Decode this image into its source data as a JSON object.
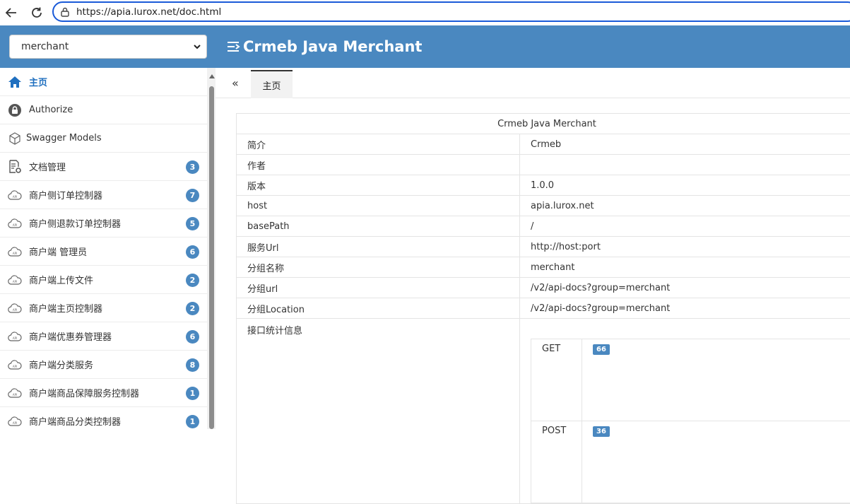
{
  "browser": {
    "url": "https://apia.lurox.net/doc.html",
    "back_icon": "arrow-left-icon",
    "reload_icon": "reload-icon"
  },
  "header": {
    "group_select": "merchant",
    "title": "Crmeb Java Merchant",
    "accent": "#4a88c0"
  },
  "sidebar": {
    "items": [
      {
        "label": "主页",
        "icon": "home-icon",
        "badge": ""
      },
      {
        "label": "Authorize",
        "icon": "lock-icon",
        "badge": ""
      },
      {
        "label": "Swagger Models",
        "icon": "cube-icon",
        "badge": ""
      },
      {
        "label": "文档管理",
        "icon": "doc-settings-icon",
        "badge": "3"
      },
      {
        "label": "商户侧订单控制器",
        "icon": "api-cloud-icon",
        "badge": "7"
      },
      {
        "label": "商户侧退款订单控制器",
        "icon": "api-cloud-icon",
        "badge": "5"
      },
      {
        "label": "商户端 管理员",
        "icon": "api-cloud-icon",
        "badge": "6"
      },
      {
        "label": "商户端上传文件",
        "icon": "api-cloud-icon",
        "badge": "2"
      },
      {
        "label": "商户端主页控制器",
        "icon": "api-cloud-icon",
        "badge": "2"
      },
      {
        "label": "商户端优惠券管理器",
        "icon": "api-cloud-icon",
        "badge": "6"
      },
      {
        "label": "商户端分类服务",
        "icon": "api-cloud-icon",
        "badge": "8"
      },
      {
        "label": "商户端商品保障服务控制器",
        "icon": "api-cloud-icon",
        "badge": "1"
      },
      {
        "label": "商户端商品分类控制器",
        "icon": "api-cloud-icon",
        "badge": "1"
      }
    ]
  },
  "tabs": {
    "collapse": "«",
    "active": "主页"
  },
  "doc": {
    "title": "Crmeb Java Merchant",
    "rows": [
      {
        "key": "简介",
        "value": "Crmeb"
      },
      {
        "key": "作者",
        "value": ""
      },
      {
        "key": "版本",
        "value": "1.0.0"
      },
      {
        "key": "host",
        "value": "apia.lurox.net"
      },
      {
        "key": "basePath",
        "value": "/"
      },
      {
        "key": "服务Url",
        "value": "http://host:port"
      },
      {
        "key": "分组名称",
        "value": "merchant"
      },
      {
        "key": "分组url",
        "value": "/v2/api-docs?group=merchant"
      },
      {
        "key": "分组Location",
        "value": "/v2/api-docs?group=merchant"
      }
    ],
    "stats_label": "接口统计信息",
    "stats": [
      {
        "method": "GET",
        "count": "66"
      },
      {
        "method": "POST",
        "count": "36"
      }
    ]
  }
}
